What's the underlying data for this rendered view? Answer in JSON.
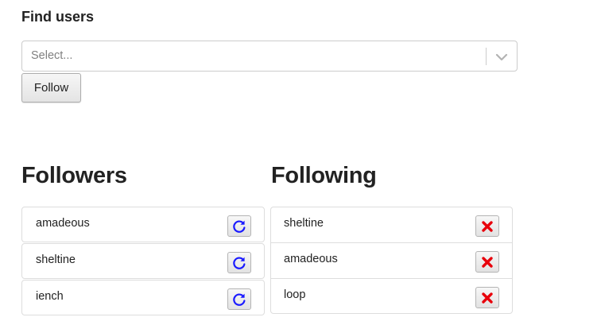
{
  "find": {
    "title": "Find users",
    "select_placeholder": "Select...",
    "follow_label": "Follow"
  },
  "followers": {
    "title": "Followers",
    "items": [
      {
        "name": "amadeous",
        "action_icon": "refresh-icon"
      },
      {
        "name": "sheltine",
        "action_icon": "refresh-icon"
      },
      {
        "name": "iench",
        "action_icon": "refresh-icon"
      }
    ]
  },
  "following": {
    "title": "Following",
    "items": [
      {
        "name": "sheltine",
        "action_icon": "close-icon"
      },
      {
        "name": "amadeous",
        "action_icon": "close-icon"
      },
      {
        "name": "loop",
        "action_icon": "close-icon"
      }
    ]
  },
  "colors": {
    "refresh_icon": "#1a1aff",
    "remove_icon": "#e8000b",
    "border": "#dddddd"
  }
}
